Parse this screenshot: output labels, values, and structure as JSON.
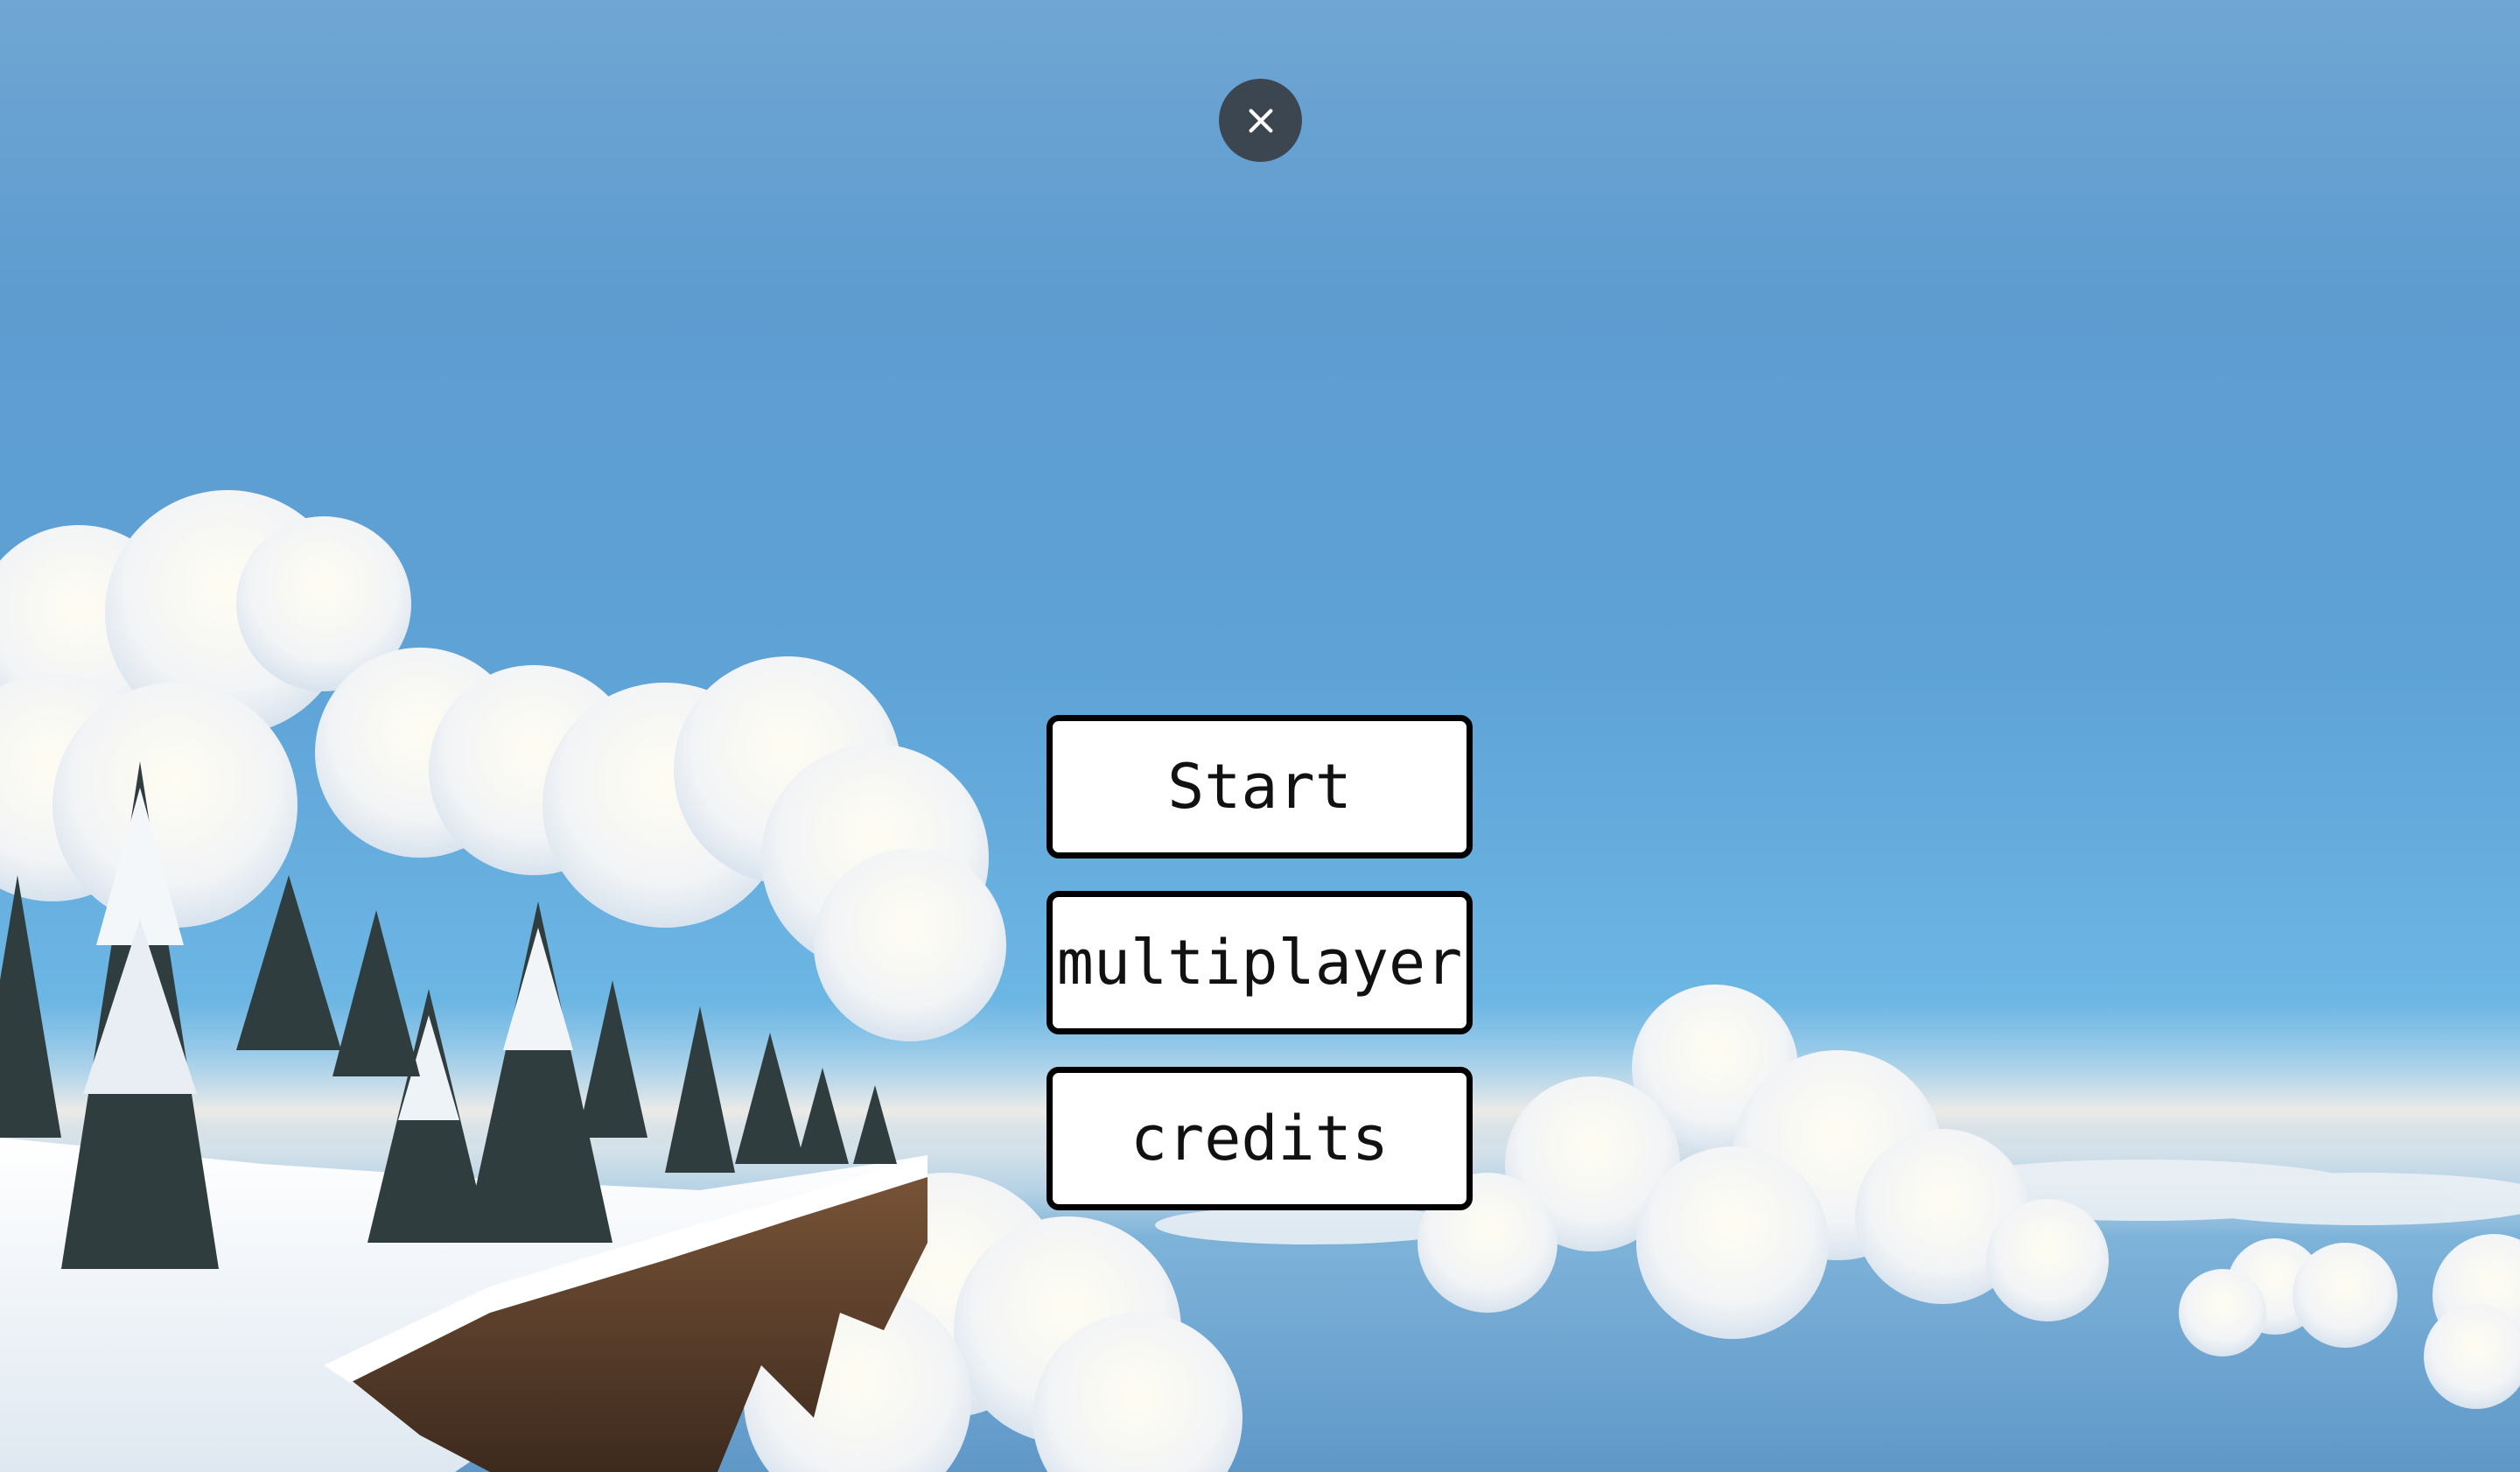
{
  "close_button": {
    "icon": "close-icon"
  },
  "menu": {
    "buttons": [
      {
        "label": "Start"
      },
      {
        "label": "multiplayer"
      },
      {
        "label": "credits"
      }
    ]
  },
  "colors": {
    "button_bg": "#ffffff",
    "button_border": "#000000",
    "close_bg": "#3b4650",
    "sky": "#5e9cd0"
  }
}
